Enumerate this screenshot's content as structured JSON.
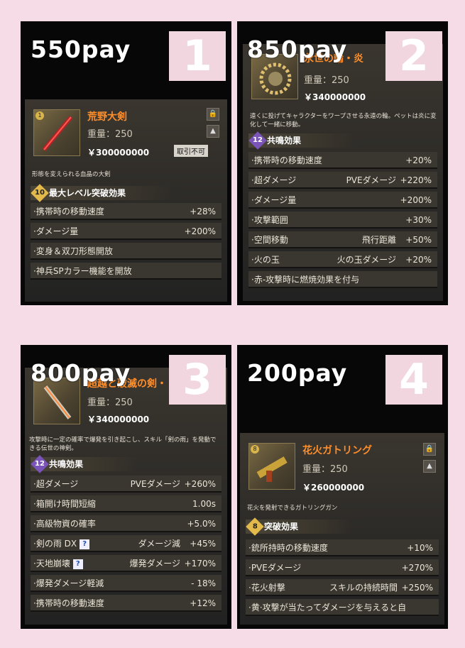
{
  "panels": [
    {
      "price": "550pay",
      "number": "1",
      "item": {
        "name": "荒野大剣",
        "weight": "重量：250",
        "yen": "￥300000000",
        "tag": "取引不可",
        "level": "1",
        "description": "形態を変えられる血晶の大剣"
      },
      "section": {
        "badge": "10",
        "title": "最大レベル突破効果"
      },
      "rows": [
        {
          "label": "·携帯時の移動速度",
          "mid": "",
          "value": "+28%"
        },
        {
          "label": "·ダメージ量",
          "mid": "",
          "value": "+200%"
        },
        {
          "label": "·変身＆双刀形態開放",
          "mid": "",
          "value": ""
        },
        {
          "label": "·神兵SPカラー機能を開放",
          "mid": "",
          "value": ""
        }
      ]
    },
    {
      "price": "850pay",
      "number": "2",
      "item": {
        "name": "永世の輪・炎",
        "weight": "重量：250",
        "yen": "￥340000000",
        "description": "遠くに投げてキャラクターをワープさせる永遠の輪。ペットは炎に変化して一緒に移動。"
      },
      "section": {
        "badge": "12",
        "title": "共鳴効果"
      },
      "rows": [
        {
          "label": "·携帯時の移動速度",
          "mid": "",
          "value": "+20%"
        },
        {
          "label": "·超ダメージ",
          "mid": "PVEダメージ",
          "value": "+220%"
        },
        {
          "label": "·ダメージ量",
          "mid": "",
          "value": "+200%"
        },
        {
          "label": "·攻撃範囲",
          "mid": "",
          "value": "+30%"
        },
        {
          "label": "·空間移動",
          "mid": "飛行距離",
          "value": "+50%"
        },
        {
          "label": "·火の玉",
          "mid": "火の玉ダメージ",
          "value": "+20%"
        },
        {
          "label": "·赤-攻撃時に燃焼効果を付与",
          "mid": "",
          "value": ""
        }
      ]
    },
    {
      "price": "800pay",
      "number": "3",
      "item": {
        "name": "超越と破滅の剣・",
        "weight": "重量：250",
        "yen": "￥340000000",
        "description": "攻撃時に一定の確率で爆発を引き起こし、スキル「剣の雨」を発動できる伝世の神剣。"
      },
      "section": {
        "badge": "12",
        "title": "共鳴効果"
      },
      "rows": [
        {
          "label": "·超ダメージ",
          "mid": "PVEダメージ",
          "value": "+260%"
        },
        {
          "label": "·箱開け時間短縮",
          "mid": "",
          "value": "1.00s"
        },
        {
          "label": "·高級物資の確率",
          "mid": "",
          "value": "+5.0%"
        },
        {
          "label": "·剣の雨 DX",
          "mid": "ダメージ減",
          "value": "+45%",
          "q": "?"
        },
        {
          "label": "·天地崩壊",
          "mid": "爆発ダメージ",
          "value": "+170%",
          "q": "?"
        },
        {
          "label": "·爆発ダメージ軽減",
          "mid": "",
          "value": "- 18%"
        },
        {
          "label": "·携帯時の移動速度",
          "mid": "",
          "value": "+12%"
        }
      ]
    },
    {
      "price": "200pay",
      "number": "4",
      "item": {
        "name": "花火ガトリング",
        "weight": "重量：250",
        "yen": "￥260000000",
        "level": "8",
        "description": "花火を発射できるガトリングガン"
      },
      "section": {
        "badge": "8",
        "title": "突破効果"
      },
      "rows": [
        {
          "label": "·銃所持時の移動速度",
          "mid": "",
          "value": "+10%"
        },
        {
          "label": "·PVEダメージ",
          "mid": "",
          "value": "+270%"
        },
        {
          "label": "·花火射撃",
          "mid": "スキルの持続時間",
          "value": "+250%"
        },
        {
          "label": "·黄·攻撃が当たってダメージを与えると自",
          "mid": "",
          "value": ""
        }
      ]
    }
  ],
  "icons": {
    "lock": "lock-icon",
    "pin": "pin-icon"
  },
  "colors": {
    "background": "#f6dce6",
    "number_box": "#f1d5df",
    "item_name": "#ff8e2b",
    "panel": "#070707"
  }
}
